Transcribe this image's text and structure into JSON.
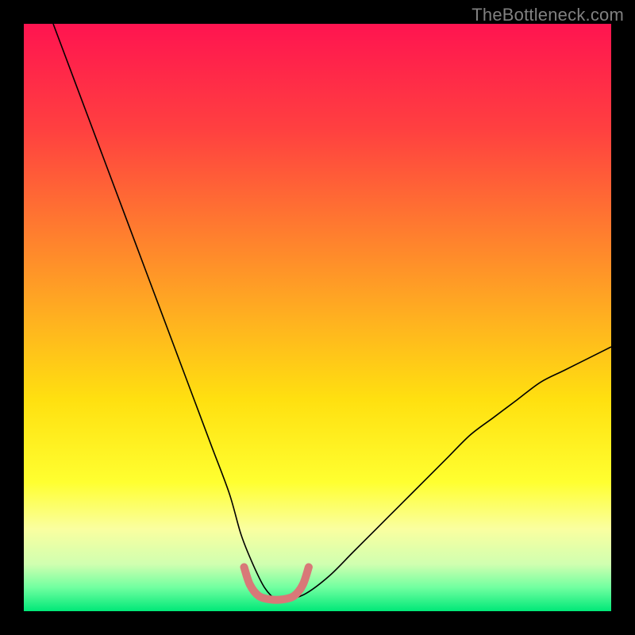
{
  "watermark": "TheBottleneck.com",
  "chart_data": {
    "type": "line",
    "title": "",
    "xlabel": "",
    "ylabel": "",
    "xlim": [
      0,
      100
    ],
    "ylim": [
      0,
      100
    ],
    "background": {
      "type": "vertical-gradient",
      "stops": [
        {
          "pos": 0.0,
          "color": "#ff1450"
        },
        {
          "pos": 0.18,
          "color": "#ff4040"
        },
        {
          "pos": 0.34,
          "color": "#ff7830"
        },
        {
          "pos": 0.5,
          "color": "#ffb020"
        },
        {
          "pos": 0.64,
          "color": "#ffe010"
        },
        {
          "pos": 0.78,
          "color": "#ffff30"
        },
        {
          "pos": 0.86,
          "color": "#faffa0"
        },
        {
          "pos": 0.92,
          "color": "#d0ffb0"
        },
        {
          "pos": 0.96,
          "color": "#70ffa0"
        },
        {
          "pos": 1.0,
          "color": "#00e878"
        }
      ]
    },
    "series": [
      {
        "name": "bottleneck-curve",
        "color": "#000000",
        "width": 1.6,
        "x": [
          5,
          8,
          11,
          14,
          17,
          20,
          23,
          26,
          29,
          32,
          35,
          37,
          39,
          41,
          43,
          45,
          48,
          52,
          56,
          60,
          64,
          68,
          72,
          76,
          80,
          84,
          88,
          92,
          96,
          100
        ],
        "y": [
          100,
          92,
          84,
          76,
          68,
          60,
          52,
          44,
          36,
          28,
          20,
          13,
          8,
          4,
          2,
          2,
          3,
          6,
          10,
          14,
          18,
          22,
          26,
          30,
          33,
          36,
          39,
          41,
          43,
          45
        ]
      },
      {
        "name": "optimal-zone-marker",
        "color": "#d87878",
        "width": 10,
        "cap": "round",
        "x": [
          37.5,
          38.5,
          40,
          42,
          44,
          46,
          47.5,
          48.5
        ],
        "y": [
          7.5,
          4.5,
          2.6,
          2.0,
          2.0,
          2.6,
          4.5,
          7.5
        ]
      }
    ]
  }
}
